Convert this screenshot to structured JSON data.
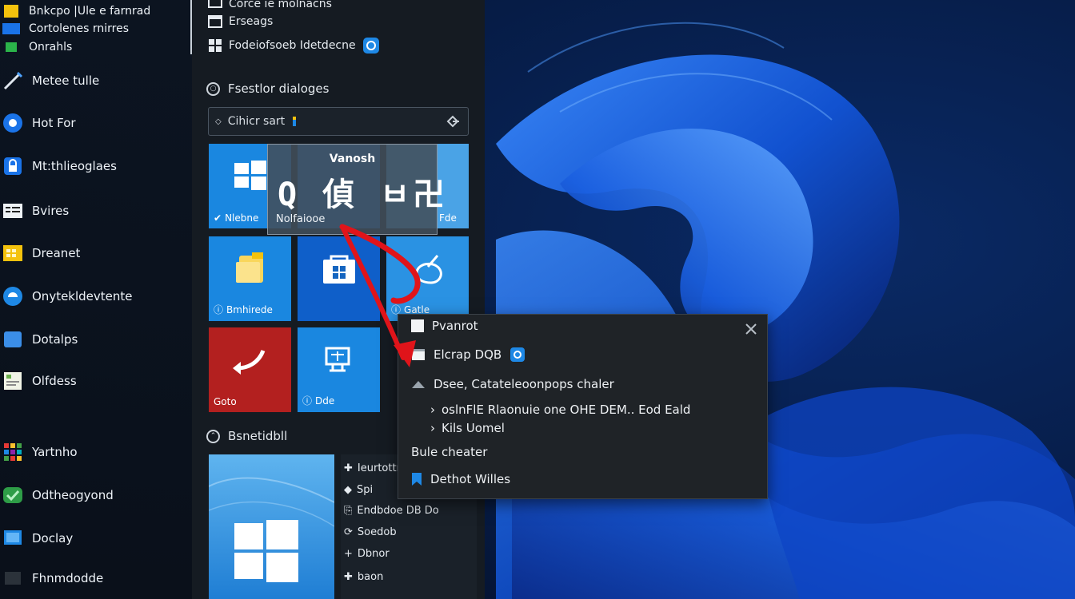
{
  "colors": {
    "accent_blue": "#0f7ad8",
    "tile_blue": "#1e88e5",
    "tile_red": "#b3201f",
    "arrow_red": "#e0141a",
    "pane_bg": "#151b22",
    "menu_bg": "#1f2327"
  },
  "app_list": {
    "top_items": [
      {
        "label": "Bnkcpo |Ule e farnrad",
        "icon": "yellow-square-icon"
      },
      {
        "label": "Cortolenes rnirres",
        "icon": "blue-rectangle-icon"
      },
      {
        "label": "Onrahls",
        "icon": "green-square-icon"
      }
    ],
    "items": [
      {
        "label": "Metee tulle",
        "icon": "pen-icon"
      },
      {
        "label": "Hot For",
        "icon": "browser-icon"
      },
      {
        "label": "Mt:thlieoglaes",
        "icon": "lock-icon"
      },
      {
        "label": "Bvires",
        "icon": "list-icon"
      },
      {
        "label": "Dreanet",
        "icon": "folder-grid-icon"
      },
      {
        "label": "Onytekldevtente",
        "icon": "edge-icon"
      },
      {
        "label": "Dotalps",
        "icon": "window-icon"
      },
      {
        "label": "Olfdess",
        "icon": "notepad-icon"
      },
      {
        "label": "Yartnho",
        "icon": "grid-apps-icon"
      },
      {
        "label": "Odtheogyond",
        "icon": "green-app-icon"
      },
      {
        "label": "Doclay",
        "icon": "monitor-icon"
      },
      {
        "label": "Fhnmdodde",
        "icon": "dark-app-icon"
      }
    ]
  },
  "start_pane": {
    "top_rows": [
      {
        "label": "Corce ie molnacns"
      },
      {
        "label": "Erseags"
      },
      {
        "label": "Fodeiofsoeb Idetdecne"
      }
    ],
    "section1": "Fsestlor dialoges",
    "search_placeholder": "Cihicr sart",
    "tiles": [
      {
        "label": "Nlebne",
        "icon": "windows-logo-icon"
      },
      {
        "label": "",
        "icon": "blank-icon"
      },
      {
        "label": "Fde",
        "icon": "blank-icon"
      },
      {
        "label": "Bmhirede",
        "icon": "file-explorer-icon"
      },
      {
        "label": "",
        "icon": "store-icon"
      },
      {
        "label": "Gatle",
        "icon": "paint-icon"
      },
      {
        "label": "Goto",
        "icon": "arrow-back-icon"
      },
      {
        "label": "Dde",
        "icon": "monitor-share-icon"
      }
    ],
    "tooltip": {
      "title": "Vanosh",
      "big_text": "Q 偵 ㅂ卍",
      "subtitle": "Nolfaiooe"
    },
    "section2": "Bsnetidbll",
    "side_list": [
      {
        "label": "Ieurtottr",
        "icon": "pin-icon"
      },
      {
        "label": "Spi",
        "icon": "diamond-icon"
      },
      {
        "label": "Endbdoe DB Do",
        "icon": "share-icon"
      },
      {
        "label": "Soedob",
        "icon": "refresh-icon"
      },
      {
        "label": "Dbnor",
        "icon": "plus-small-icon"
      },
      {
        "label": "baon",
        "icon": "plus-icon"
      }
    ]
  },
  "context_menu": {
    "items": [
      {
        "label": "Pvanrot"
      },
      {
        "label": "Elcrap DQB"
      },
      {
        "label": "Dsee, Catateleoonpops chaler"
      }
    ],
    "sub_items": [
      {
        "label": "oslnFlE Rlaonuie one OHE DEM.. Eod Eald"
      },
      {
        "label": "Kils Uomel"
      }
    ],
    "plain_item": "Bule cheater",
    "last_item": "Dethot Willes"
  }
}
